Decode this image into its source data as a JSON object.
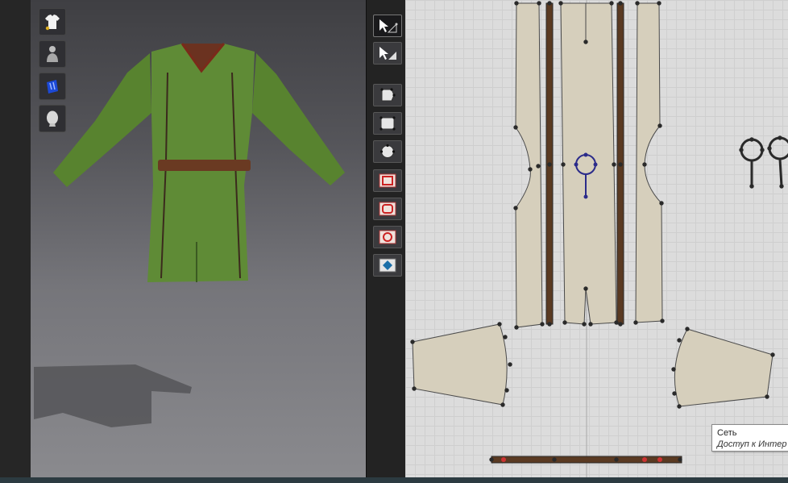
{
  "viewport3d": {
    "avatar_tools": [
      {
        "name": "garment-icon"
      },
      {
        "name": "avatar-icon"
      },
      {
        "name": "fabric-icon"
      },
      {
        "name": "head-icon"
      }
    ]
  },
  "toolbar": {
    "tools": [
      {
        "name": "select-move-tool",
        "active": true
      },
      {
        "name": "transform-pattern-tool",
        "active": false
      },
      {
        "name": "edit-pattern-tool",
        "active": false
      },
      {
        "name": "rectangle-tool",
        "active": false
      },
      {
        "name": "circle-tool",
        "active": false
      },
      {
        "name": "internal-rectangle-tool",
        "active": false
      },
      {
        "name": "internal-polygon-tool",
        "active": false
      },
      {
        "name": "internal-circle-tool",
        "active": false
      },
      {
        "name": "dart-tool",
        "active": false
      }
    ]
  },
  "tooltip": {
    "title": "Сеть",
    "description": "Доступ к Интер"
  },
  "colors": {
    "garment": "#5d8a34",
    "belt": "#6a3a22",
    "fabric": "#d6cfbc",
    "point": "#2a2a2a",
    "selected": "#2b2b8a"
  }
}
